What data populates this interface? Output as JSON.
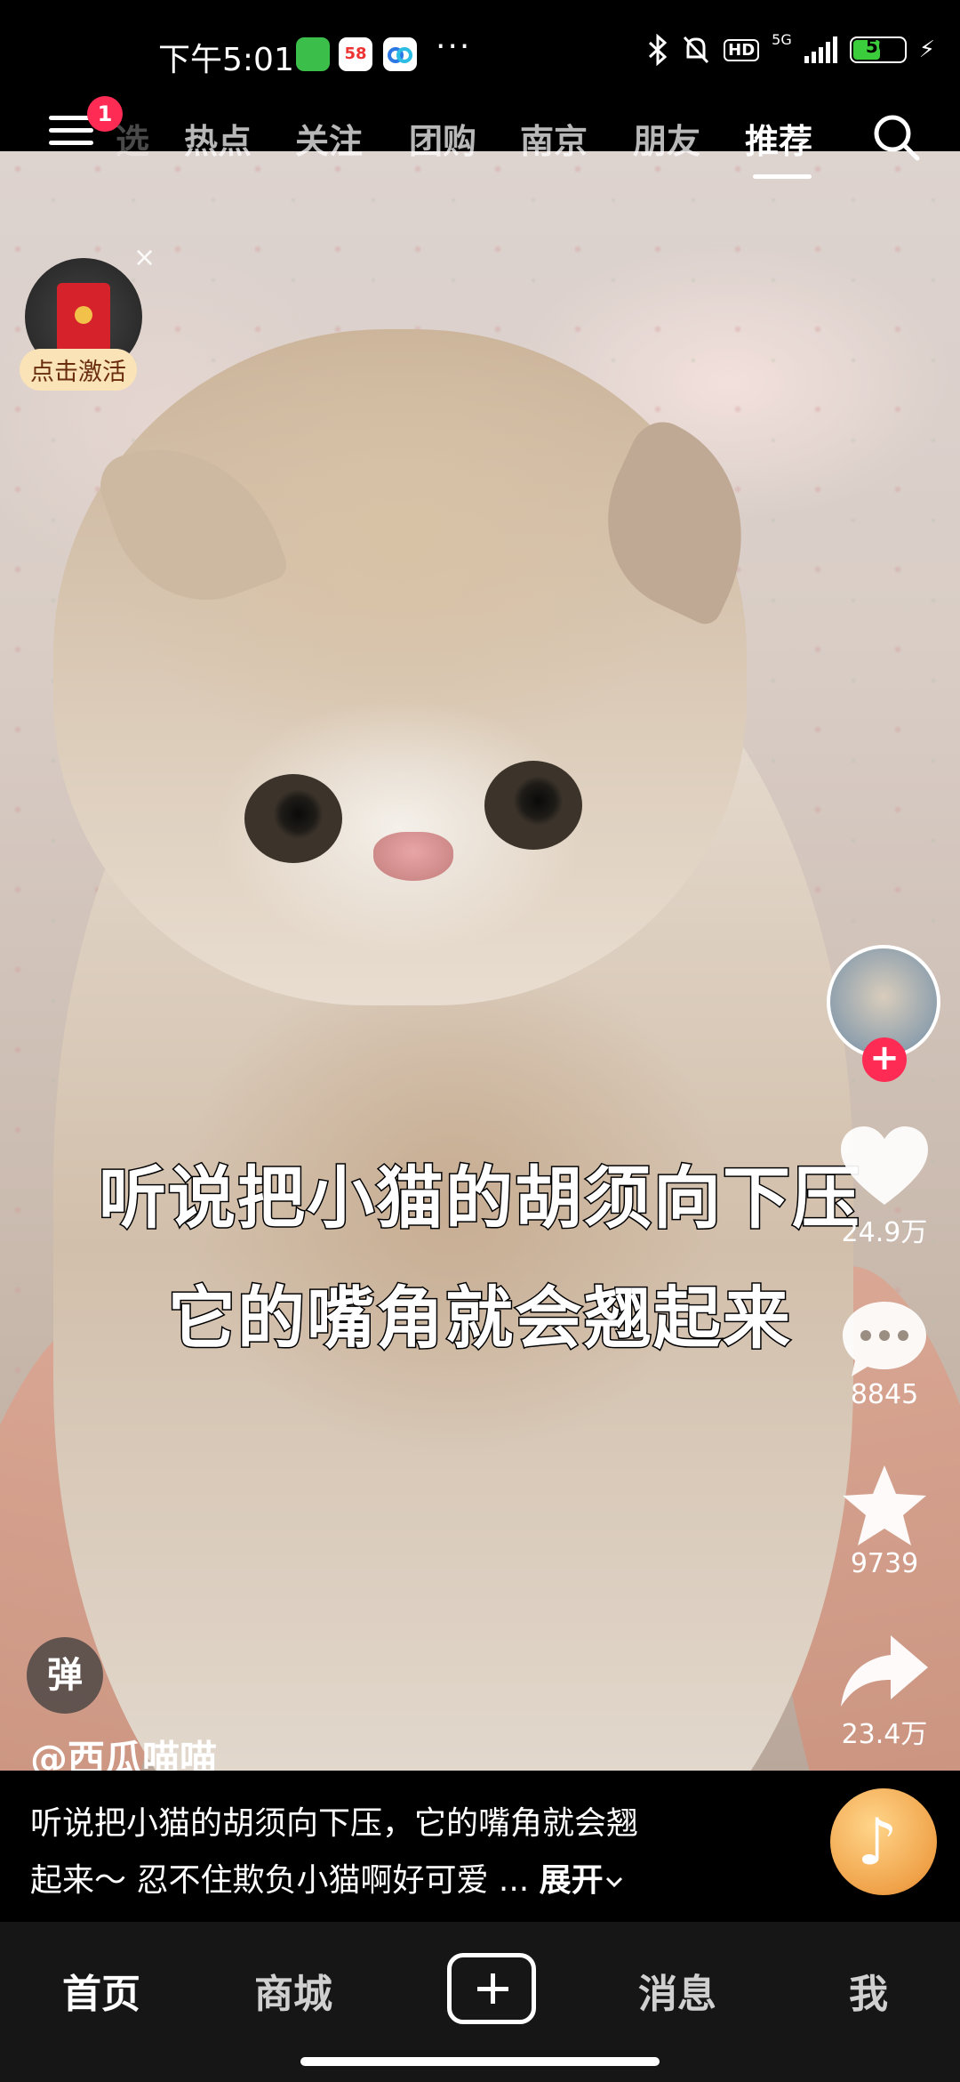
{
  "status_bar": {
    "time": "下午5:01",
    "apps": [
      "green-app-icon",
      "58-app-icon",
      "baidu-cloud-icon"
    ],
    "more": "···",
    "icons": [
      "bluetooth-icon",
      "mute-bell-icon"
    ],
    "hd": "HD",
    "network": "5G",
    "battery": 56
  },
  "top_nav": {
    "menu_badge": "1",
    "partial_tab": "选",
    "tabs": [
      "热点",
      "关注",
      "团购",
      "南京",
      "朋友",
      "推荐"
    ],
    "active_tab": "推荐"
  },
  "red_packet": {
    "label": "点击激活",
    "close": "×"
  },
  "video": {
    "caption_line1": "听说把小猫的胡须向下压",
    "caption_line2": "它的嘴角就会翘起来"
  },
  "rail": {
    "likes": "24.9万",
    "comments": "8845",
    "favorites": "9739",
    "shares": "23.4万",
    "follow": "+"
  },
  "danmaku": "弹",
  "author": "@西瓜喵喵",
  "description": {
    "line1": "听说把小猫的胡须向下压，它的嘴角就会翘",
    "line2": "起来～ 忍不住欺负小猫啊好可爱 ...",
    "expand": "展开"
  },
  "bottom_nav": {
    "home": "首页",
    "mall": "商城",
    "messages": "消息",
    "me": "我",
    "active": "首页"
  },
  "colors": {
    "accent": "#fe2c55",
    "battery": "#3ccd3c",
    "nav_bg": "#161616"
  }
}
